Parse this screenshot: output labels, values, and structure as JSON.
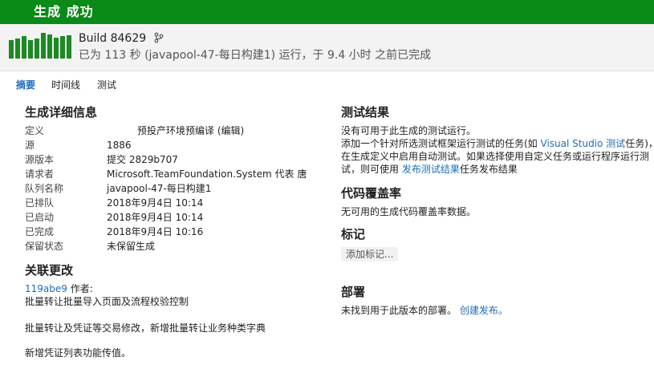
{
  "banner": {
    "title": "生成 成功"
  },
  "build": {
    "name": "Build 84629",
    "description": "已为 113 秒 (javapool-47-每日构建1) 运行，于 9.4 小时 之前已完成",
    "bar_levels": [
      0.72,
      0.78,
      0.88,
      0.72,
      0.78,
      1.0,
      0.94,
      0.82,
      0.86,
      0.9
    ],
    "accent_color": "#0a8a16"
  },
  "tabs": [
    {
      "label": "摘要",
      "active": true
    },
    {
      "label": "时间线",
      "active": false
    },
    {
      "label": "测试",
      "active": false
    }
  ],
  "details": {
    "title": "生成详细信息",
    "rows": [
      {
        "key": "定义",
        "value": "预投产环境预编译 (编辑)"
      },
      {
        "key": "源",
        "value": "1886"
      },
      {
        "key": "源版本",
        "value": "提交 2829b707"
      },
      {
        "key": "请求者",
        "value": "Microsoft.TeamFoundation.System 代表 唐"
      },
      {
        "key": "队列名称",
        "value": "javapool-47-每日构建1"
      },
      {
        "key": "已排队",
        "value": "2018年9月4日 10:14"
      },
      {
        "key": "已启动",
        "value": "2018年9月4日 10:14"
      },
      {
        "key": "已完成",
        "value": "2018年9月4日 10:16"
      },
      {
        "key": "保留状态",
        "value": "未保留生成"
      }
    ]
  },
  "changes": {
    "title": "关联更改",
    "commit": "119abe9",
    "author_label": "作者:",
    "lines": [
      "批量转让批量导入页面及流程校验控制",
      "批量转让及凭证等交易修改，新增批量转让业务种类字典",
      "新增凭证列表功能传值。"
    ]
  },
  "tests": {
    "title": "测试结果",
    "line1": "没有可用于此生成的测试运行。",
    "line2_a": "添加一个针对所选测试框架运行测试的任务(如 ",
    "line2_link": "Visual Studio 测试",
    "line2_b": "任务)，",
    "line3": "在生成定义中启用自动测试。如果选择使用自定义任务或运行程序运行测",
    "line4_a": "试，则可使用 ",
    "line4_link": "发布测试结果",
    "line4_b": "任务发布结果"
  },
  "coverage": {
    "title": "代码覆盖率",
    "text": "无可用的生成代码覆盖率数据。"
  },
  "tags": {
    "title": "标记",
    "add_label": "添加标记..."
  },
  "deploy": {
    "title": "部署",
    "text": "未找到用于此版本的部署。",
    "link": "创建发布。"
  }
}
